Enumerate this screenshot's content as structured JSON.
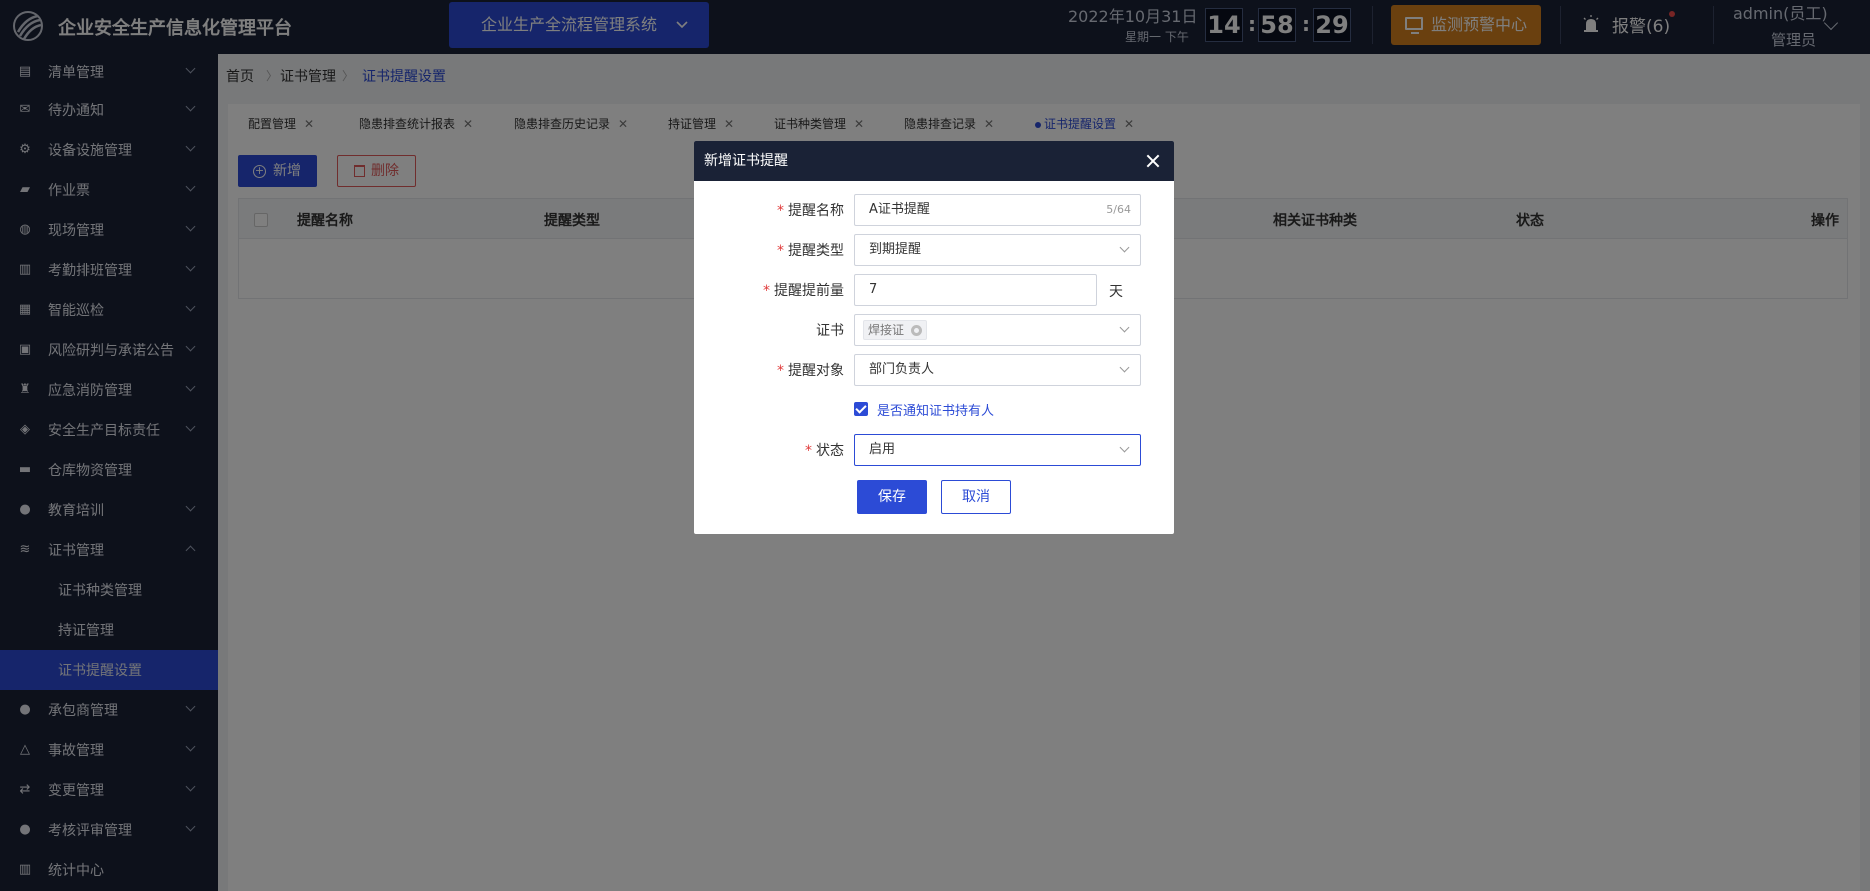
{
  "header": {
    "app_title": "企业安全生产信息化管理平台",
    "system_select": "企业生产全流程管理系统",
    "date": "2022年10月31日",
    "weekday": "星期一  下午",
    "clock": {
      "hour": "14",
      "minute": "58",
      "second": "29"
    },
    "monitor_label": "监测预警中心",
    "alarm_label": "报警(6)",
    "user_name": "admin(员工)",
    "user_role": "管理员"
  },
  "sidebar": {
    "items": [
      {
        "label": "清单管理",
        "icon": "list-icon"
      },
      {
        "label": "待办通知",
        "icon": "mail-icon"
      },
      {
        "label": "设备设施管理",
        "icon": "devices-icon"
      },
      {
        "label": "作业票",
        "icon": "ticket-icon"
      },
      {
        "label": "现场管理",
        "icon": "globe-icon"
      },
      {
        "label": "考勤排班管理",
        "icon": "bar-chart-icon"
      },
      {
        "label": "智能巡检",
        "icon": "grid-icon"
      },
      {
        "label": "风险研判与承诺公告",
        "icon": "briefcase-icon"
      },
      {
        "label": "应急消防管理",
        "icon": "extinguisher-icon"
      },
      {
        "label": "安全生产目标责任",
        "icon": "target-icon"
      },
      {
        "label": "仓库物资管理",
        "icon": "folder-icon"
      },
      {
        "label": "教育培训",
        "icon": "person-icon"
      },
      {
        "label": "证书管理",
        "icon": "layers-icon"
      }
    ],
    "cert_submenu": [
      "证书种类管理",
      "持证管理",
      "证书提醒设置"
    ],
    "items_after": [
      {
        "label": "承包商管理",
        "icon": "person-icon"
      },
      {
        "label": "事故管理",
        "icon": "triangle-icon"
      },
      {
        "label": "变更管理",
        "icon": "change-icon"
      },
      {
        "label": "考核评审管理",
        "icon": "person-icon"
      },
      {
        "label": "统计中心",
        "icon": "chart-icon"
      }
    ]
  },
  "breadcrumb": [
    "首页",
    "证书管理",
    "证书提醒设置"
  ],
  "tabs": [
    "配置管理",
    "隐患排查统计报表",
    "隐患排查历史记录",
    "持证管理",
    "证书种类管理",
    "隐患排查记录",
    "证书提醒设置"
  ],
  "toolbar": {
    "add_label": "新增",
    "delete_label": "删除"
  },
  "table": {
    "columns": [
      "提醒名称",
      "提醒类型",
      "相关证书种类",
      "状态",
      "操作"
    ]
  },
  "dialog": {
    "title": "新增证书提醒",
    "fields": {
      "name_label": "提醒名称",
      "name_value": "A证书提醒",
      "name_count": "5/64",
      "type_label": "提醒类型",
      "type_value": "到期提醒",
      "advance_label": "提醒提前量",
      "advance_value": "7",
      "advance_unit": "天",
      "cert_label": "证书",
      "cert_tag": "焊接证",
      "target_label": "提醒对象",
      "target_value": "部门负责人",
      "notify_label": "是否通知证书持有人",
      "notify_checked": true,
      "status_label": "状态",
      "status_value": "启用"
    },
    "save_label": "保存",
    "cancel_label": "取消"
  }
}
